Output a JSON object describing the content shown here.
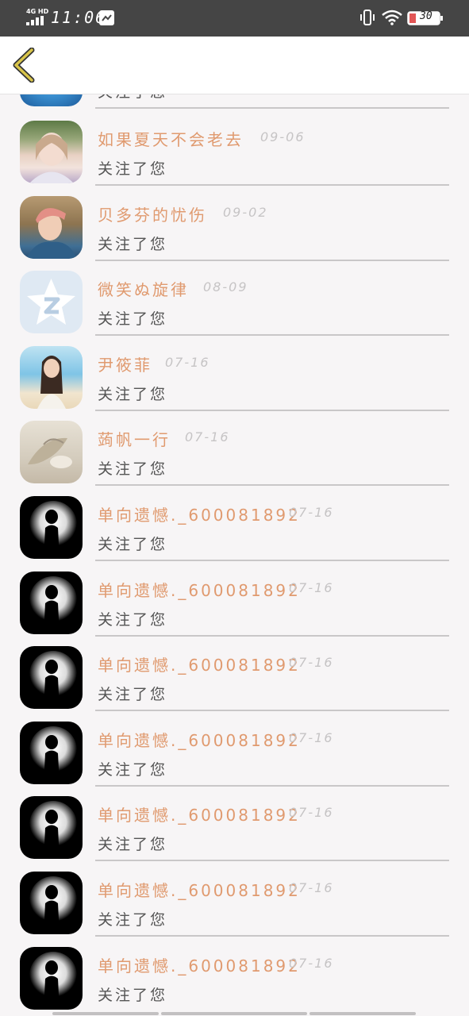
{
  "status_bar": {
    "network": "4G HD",
    "time": "11:06",
    "battery": "30",
    "icons": [
      "signal-icon",
      "message-icon",
      "vibrate-icon",
      "wifi-icon",
      "battery-icon"
    ]
  },
  "header": {
    "back_icon": "chevron-left-icon"
  },
  "rows": [
    {
      "name": "",
      "date": "",
      "action": "关注了您"
    },
    {
      "name": "如果夏天不会老去",
      "date": "09-06",
      "action": "关注了您"
    },
    {
      "name": "贝多芬的忧伤",
      "date": "09-02",
      "action": "关注了您"
    },
    {
      "name": "微笑ぬ旋律",
      "date": "08-09",
      "action": "关注了您"
    },
    {
      "name": "尹筱菲",
      "date": "07-16",
      "action": "关注了您"
    },
    {
      "name": "蒟帆一行",
      "date": "07-16",
      "action": "关注了您"
    },
    {
      "name": "单向遗憾._600081892",
      "date": "07-16",
      "action": "关注了您"
    },
    {
      "name": "单向遗憾._600081892",
      "date": "07-16",
      "action": "关注了您"
    },
    {
      "name": "单向遗憾._600081892",
      "date": "07-16",
      "action": "关注了您"
    },
    {
      "name": "单向遗憾._600081892",
      "date": "07-16",
      "action": "关注了您"
    },
    {
      "name": "单向遗憾._600081892",
      "date": "07-16",
      "action": "关注了您"
    },
    {
      "name": "单向遗憾._600081892",
      "date": "07-16",
      "action": "关注了您"
    },
    {
      "name": "单向遗憾._600081892",
      "date": "07-16",
      "action": "关注了您"
    }
  ],
  "colors": {
    "status_bar_bg": "#454545",
    "name_color": "#e09a6f",
    "date_color": "#c6c4c5",
    "back_arrow": "#d8c44a"
  }
}
